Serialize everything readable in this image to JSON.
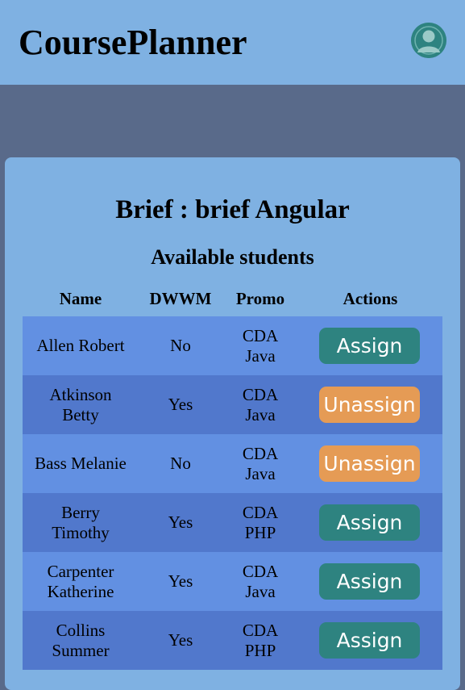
{
  "header": {
    "app_title": "CoursePlanner",
    "avatar_icon": "user-avatar-icon"
  },
  "brief": {
    "title": "Brief : brief Angular",
    "section_title": "Available students"
  },
  "table": {
    "columns": [
      "Name",
      "DWWM",
      "Promo",
      "Actions"
    ],
    "rows": [
      {
        "name_lines": [
          "Allen Robert"
        ],
        "dwwm": "No",
        "promo_lines": [
          "CDA",
          "Java"
        ],
        "action": "Assign"
      },
      {
        "name_lines": [
          "Atkinson",
          "Betty"
        ],
        "dwwm": "Yes",
        "promo_lines": [
          "CDA",
          "Java"
        ],
        "action": "Unassign"
      },
      {
        "name_lines": [
          "Bass Melanie"
        ],
        "dwwm": "No",
        "promo_lines": [
          "CDA",
          "Java"
        ],
        "action": "Unassign"
      },
      {
        "name_lines": [
          "Berry",
          "Timothy"
        ],
        "dwwm": "Yes",
        "promo_lines": [
          "CDA",
          "PHP"
        ],
        "action": "Assign"
      },
      {
        "name_lines": [
          "Carpenter",
          "Katherine"
        ],
        "dwwm": "Yes",
        "promo_lines": [
          "CDA",
          "Java"
        ],
        "action": "Assign"
      },
      {
        "name_lines": [
          "Collins",
          "Summer"
        ],
        "dwwm": "Yes",
        "promo_lines": [
          "CDA",
          "PHP"
        ],
        "action": "Assign"
      }
    ]
  },
  "colors": {
    "header_bg": "#7fb1e2",
    "page_bg": "#596a8a",
    "row_odd": "#6290e2",
    "row_even": "#5178cc",
    "assign_button": "#2e8380",
    "unassign_button": "#e59b55"
  }
}
